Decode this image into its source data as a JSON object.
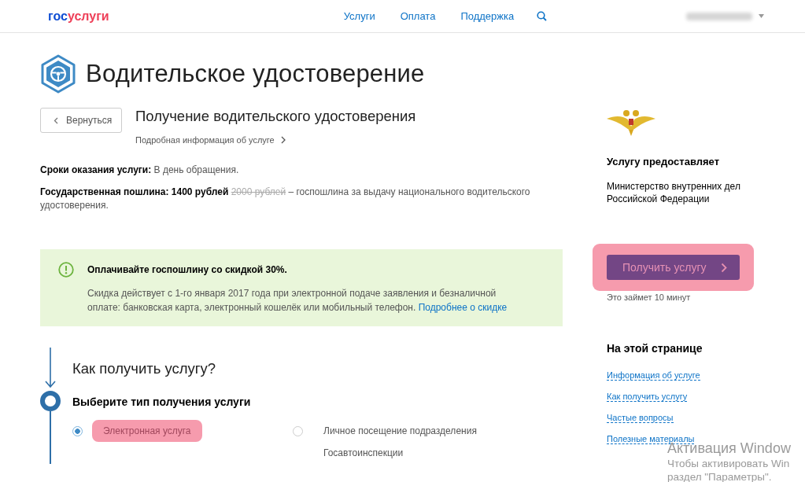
{
  "header": {
    "logo": {
      "first": "гос",
      "second": "услуги"
    },
    "nav": [
      "Услуги",
      "Оплата",
      "Поддержка"
    ]
  },
  "page_title": "Водительское удостоверение",
  "back_button": "Вернуться",
  "service": {
    "title": "Получение водительского удостоверения",
    "details_link": "Подробная информация об услуге"
  },
  "terms": [
    {
      "label": "Сроки оказания услуги:",
      "text": "В день обращения."
    },
    {
      "label": "Государственная пошлина: 1400 рублей",
      "old_price": "2000 рублей",
      "text": "– госпошлина за выдачу национального водительского удостоверения."
    }
  ],
  "notice": {
    "title": "Оплачивайте госпошлину со скидкой 30%.",
    "text": "Скидка действует с 1-го января 2017 года при электронной подаче заявления и безналичной оплате: банковская карта, электронный кошелёк или мобильный телефон.",
    "link": "Подробнее о скидке"
  },
  "steps": {
    "title": "Как получить услугу?",
    "step_title": "Выберите тип получения услуги",
    "options": [
      {
        "label": "Электронная услуга",
        "selected": true,
        "highlighted": true
      },
      {
        "label": "Личное посещение подразделения Госавтоинспекции",
        "selected": false,
        "highlighted": false
      }
    ]
  },
  "provider": {
    "heading": "Услугу предоставляет",
    "name": "Министерство внутренних дел Российской Федерации"
  },
  "action": {
    "button": "Получить услугу",
    "highlighted": true,
    "note": "Это займет 10 минут"
  },
  "on_page": {
    "heading": "На этой странице",
    "links": [
      "Информация об услуге",
      "Как получить услугу",
      "Частые вопросы",
      "Полезные материалы"
    ]
  },
  "os_notice": {
    "title": "Активация Window",
    "lines": [
      "Чтобы активировать Win",
      "раздел \"Параметры\"."
    ]
  }
}
